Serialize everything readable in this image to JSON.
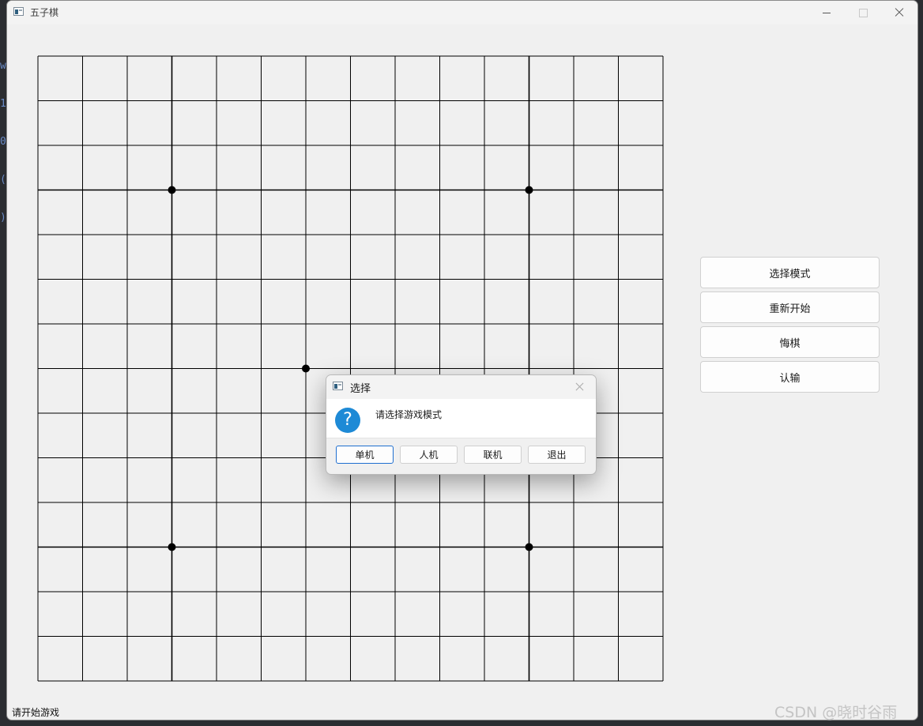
{
  "window": {
    "title": "五子棋"
  },
  "board": {
    "lines": 15,
    "star_points": [
      [
        3,
        3
      ],
      [
        3,
        11
      ],
      [
        11,
        3
      ],
      [
        11,
        11
      ],
      [
        7,
        6
      ]
    ]
  },
  "side_buttons": [
    {
      "label": "选择模式"
    },
    {
      "label": "重新开始"
    },
    {
      "label": "悔棋"
    },
    {
      "label": "认输"
    }
  ],
  "status_bar": {
    "text": "请开始游戏"
  },
  "dialog": {
    "title": "选择",
    "message": "请选择游戏模式",
    "icon": "question-icon",
    "buttons": [
      {
        "label": "单机"
      },
      {
        "label": "人机"
      },
      {
        "label": "联机"
      },
      {
        "label": "退出"
      }
    ]
  },
  "watermark": "CSDN @晓时谷雨",
  "colors": {
    "window_bg": "#f0f0f0",
    "grid": "#000000",
    "dialog_accent": "#1f6fd0",
    "question_icon": "#1e8ad6"
  }
}
